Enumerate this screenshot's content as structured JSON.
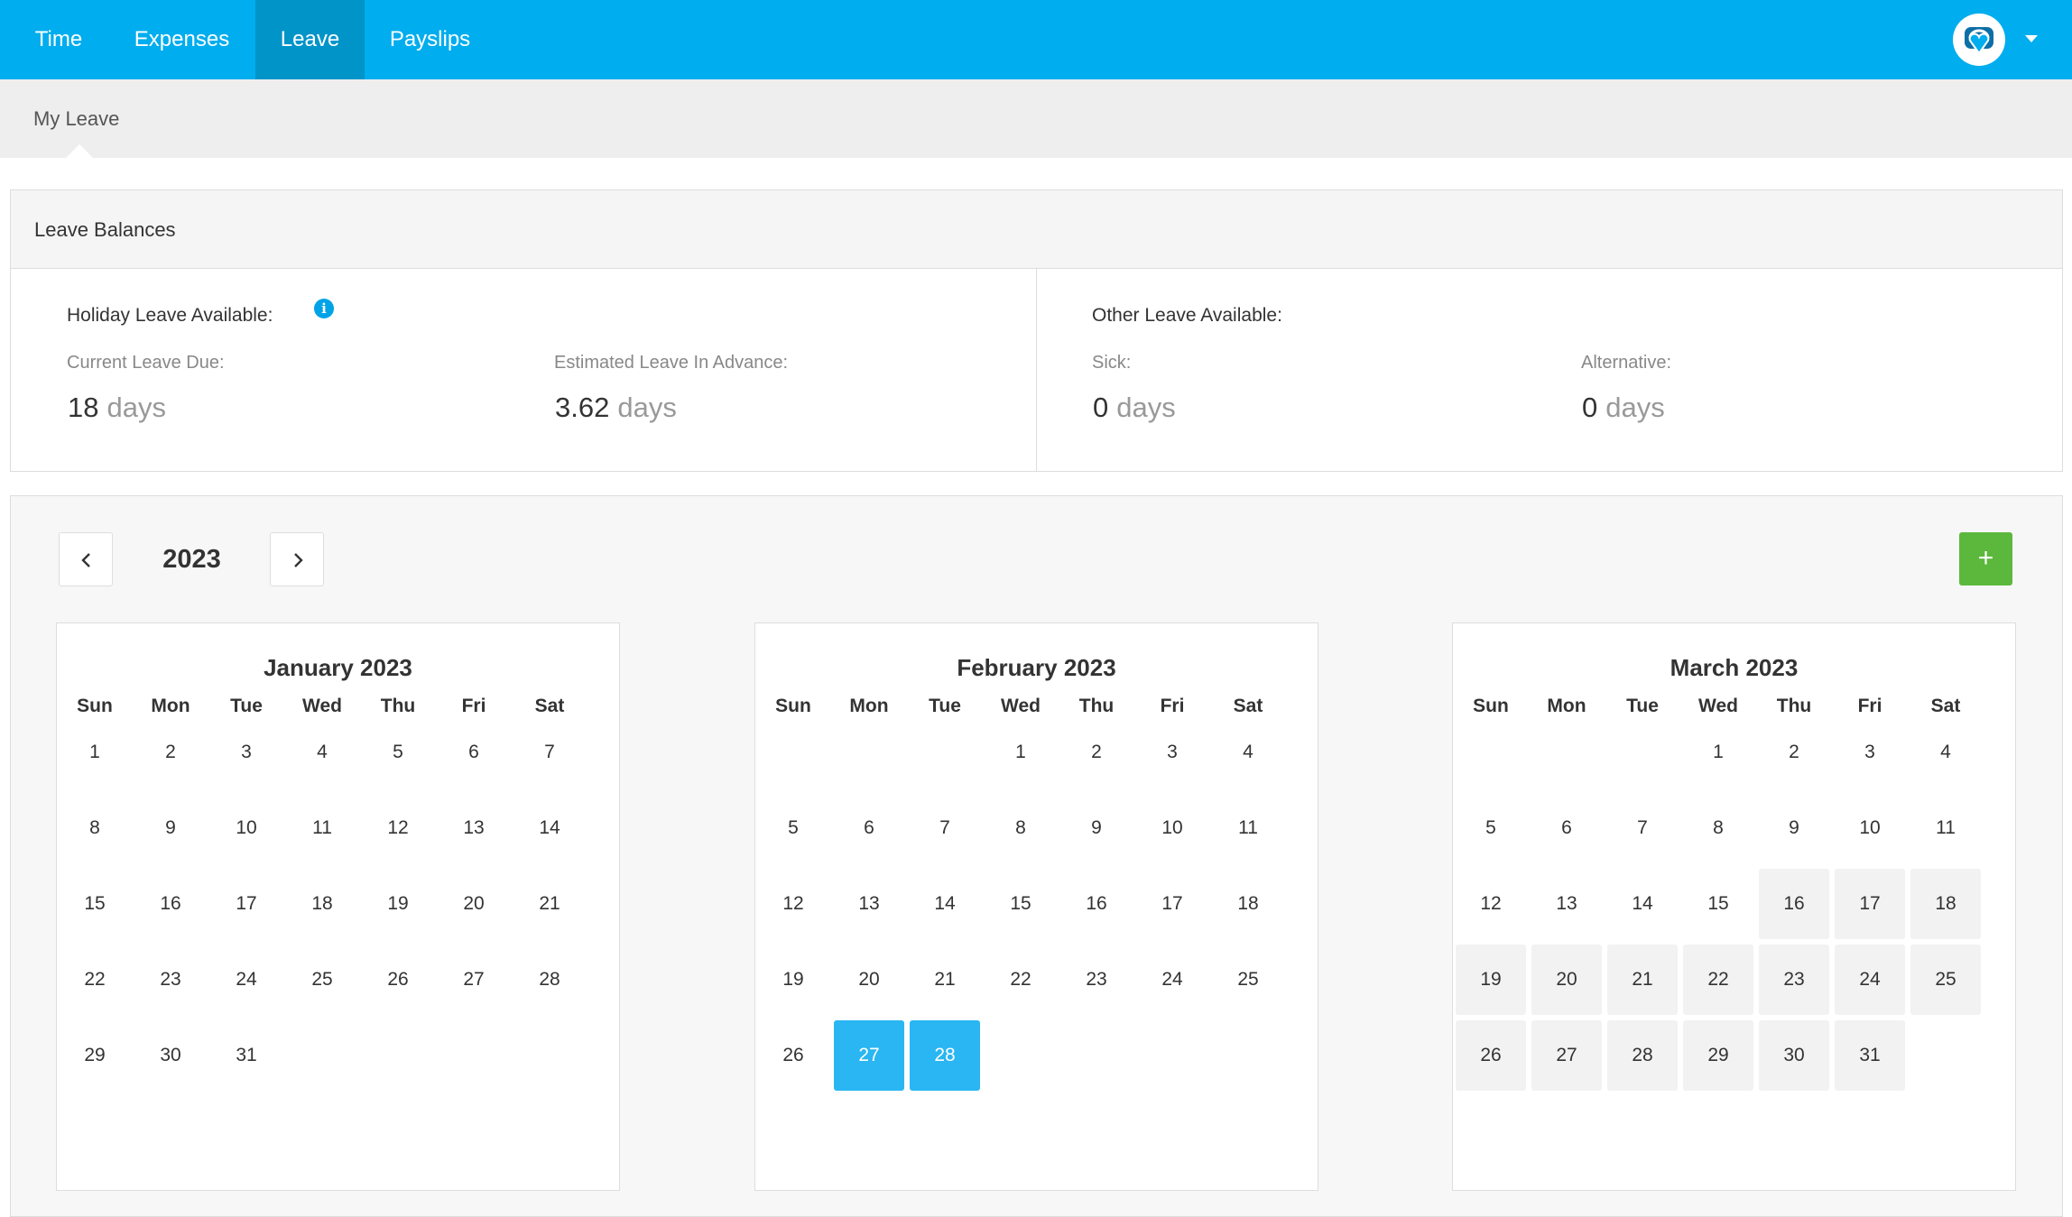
{
  "nav": {
    "tabs": [
      {
        "label": "Time"
      },
      {
        "label": "Expenses"
      },
      {
        "label": "Leave"
      },
      {
        "label": "Payslips"
      }
    ],
    "active": "Leave"
  },
  "subnav": {
    "label": "My Leave"
  },
  "balances": {
    "title": "Leave Balances",
    "holiday": {
      "title": "Holiday Leave Available:",
      "info_icon": "info-icon",
      "current": {
        "label": "Current Leave Due:",
        "value": "18",
        "unit": "days"
      },
      "advance": {
        "label": "Estimated Leave In Advance:",
        "value": "3.62",
        "unit": "days"
      }
    },
    "other": {
      "title": "Other Leave Available:",
      "sick": {
        "label": "Sick:",
        "value": "0",
        "unit": "days"
      },
      "alternative": {
        "label": "Alternative:",
        "value": "0",
        "unit": "days"
      }
    }
  },
  "calendar": {
    "year": "2023",
    "prev_icon": "chevron-left-icon",
    "next_icon": "chevron-right-icon",
    "add_label": "+",
    "weekdays": [
      "Sun",
      "Mon",
      "Tue",
      "Wed",
      "Thu",
      "Fri",
      "Sat"
    ],
    "months": [
      {
        "title": "January 2023",
        "first_weekday": 0,
        "days": 31,
        "selected": [],
        "shaded_from": null
      },
      {
        "title": "February 2023",
        "first_weekday": 3,
        "days": 28,
        "selected": [
          27,
          28
        ],
        "shaded_from": null
      },
      {
        "title": "March 2023",
        "first_weekday": 3,
        "days": 31,
        "selected": [],
        "shaded_from": 16
      }
    ]
  },
  "colors": {
    "nav_bg": "#00adee",
    "nav_active": "#0094c9",
    "selected_day": "#29b6f2",
    "add_button": "#5cb83c",
    "info_icon": "#00a3e8"
  }
}
